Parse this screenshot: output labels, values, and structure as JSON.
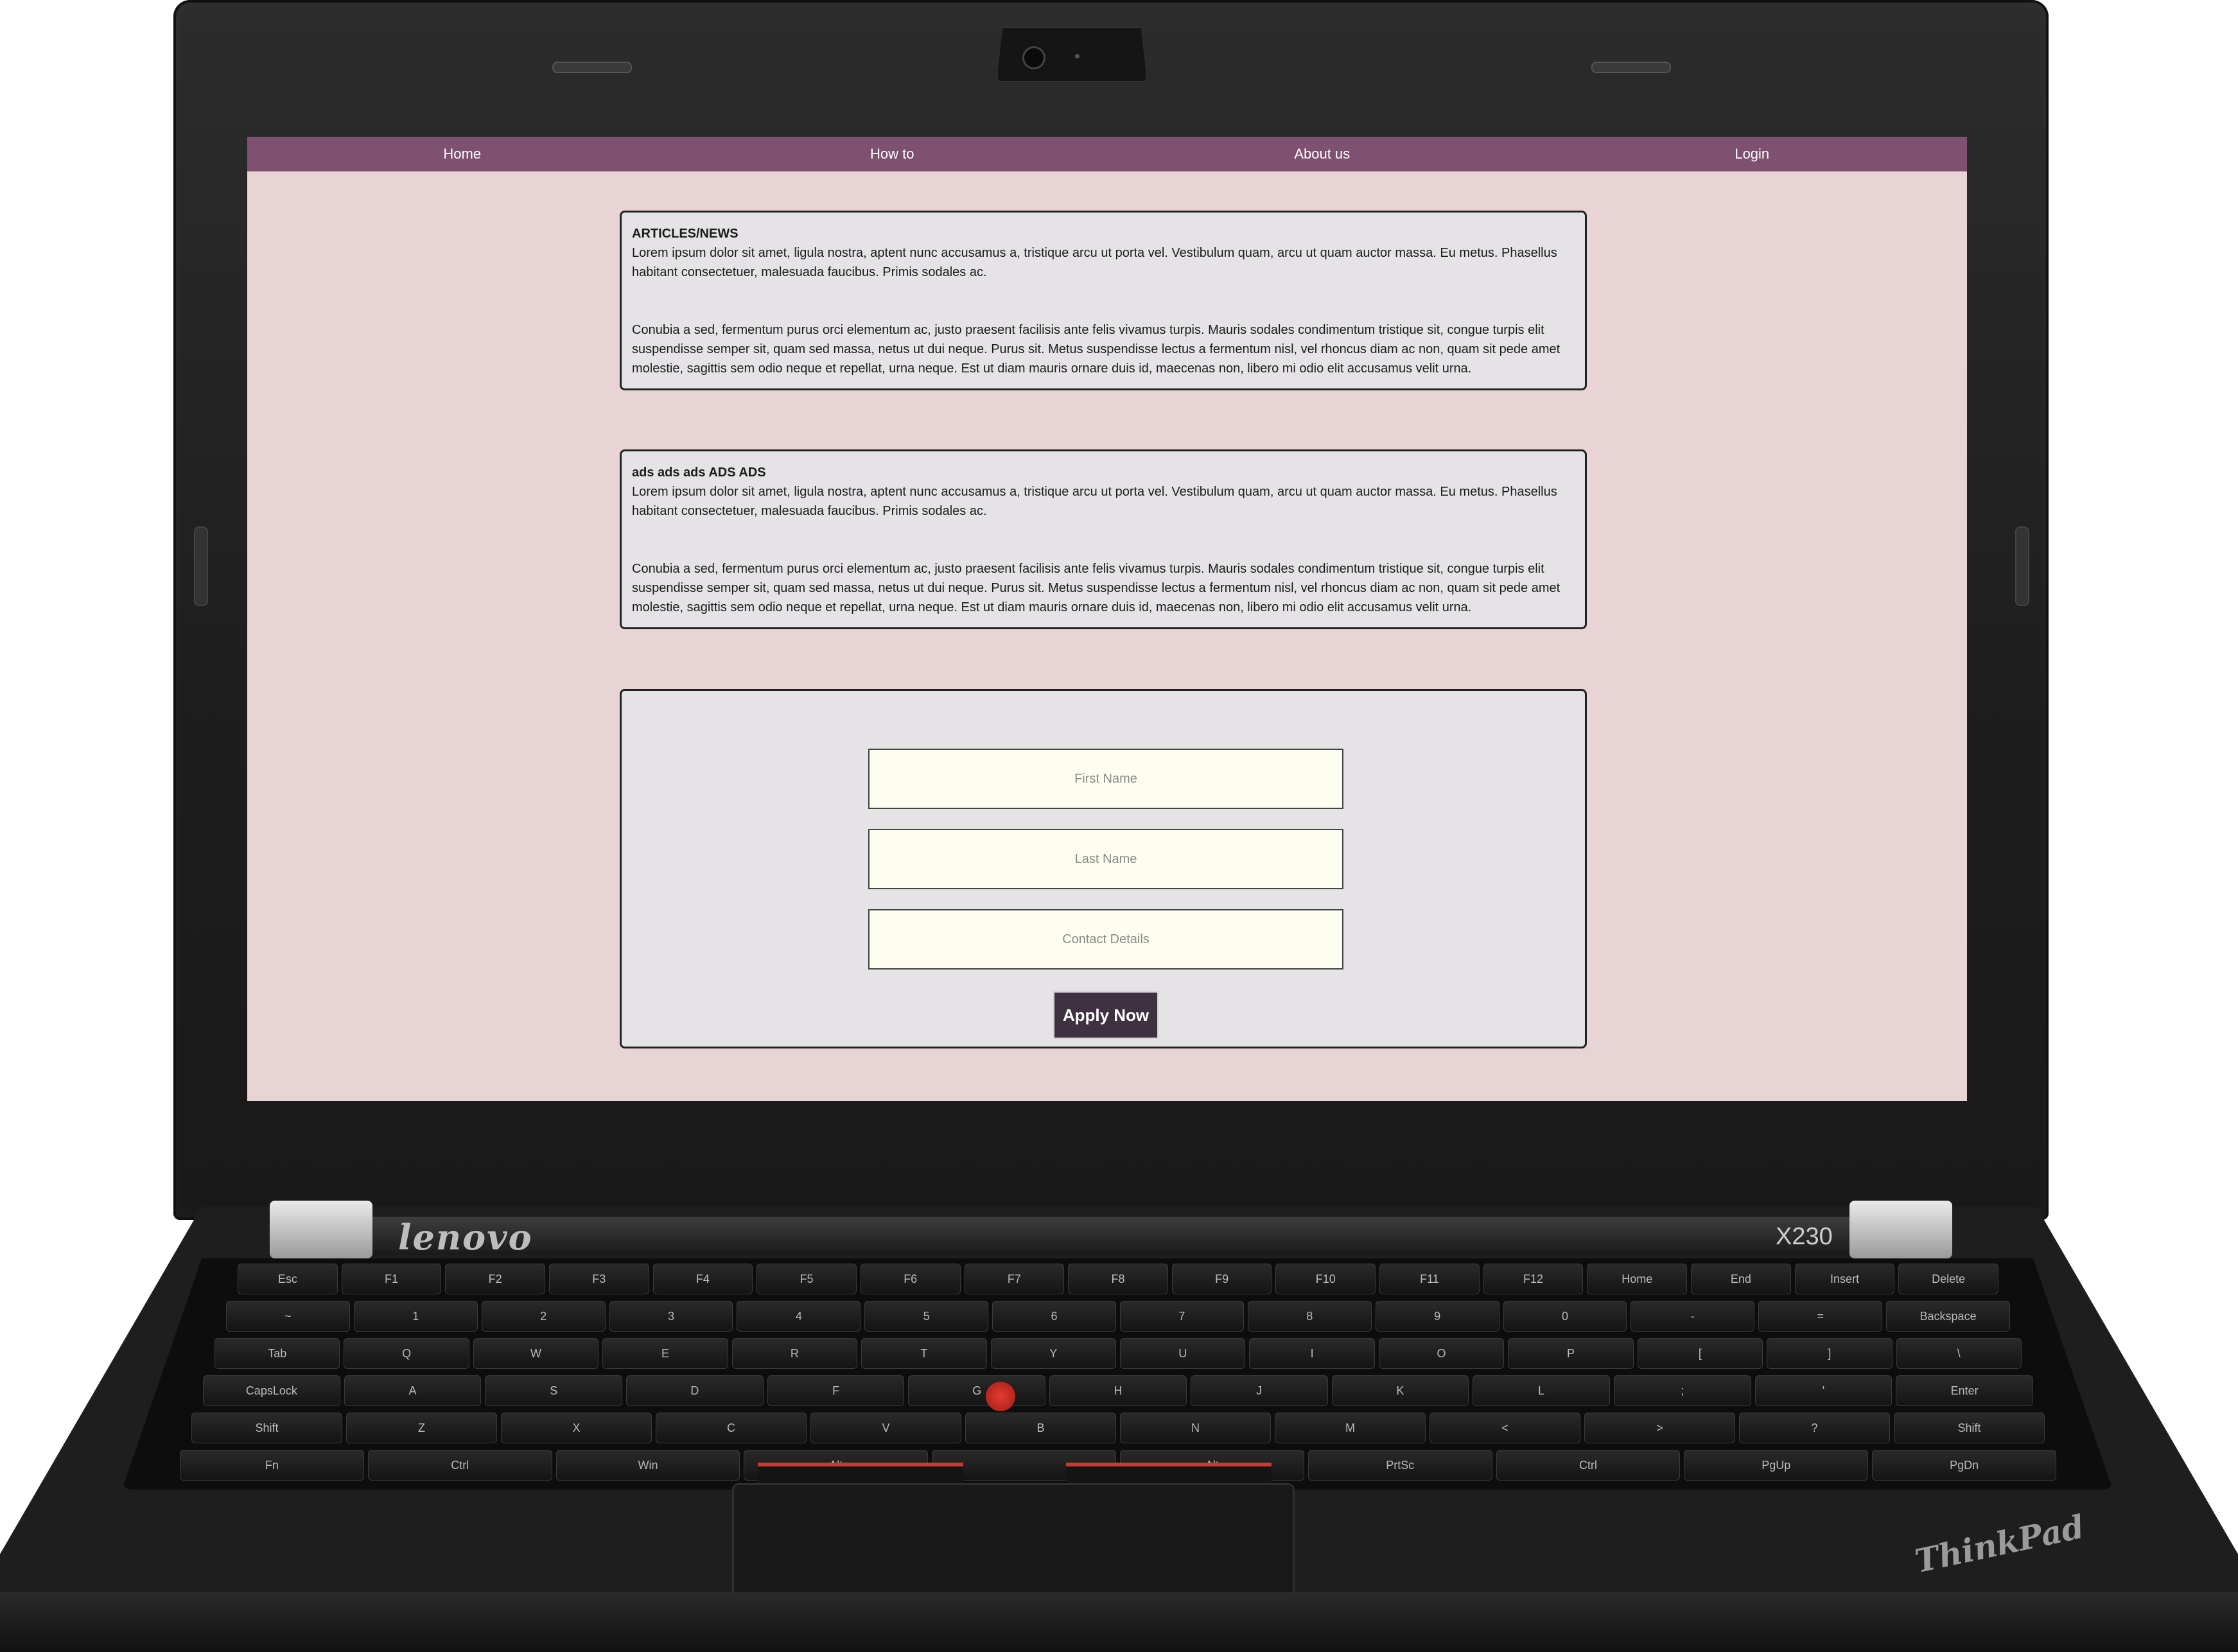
{
  "device": {
    "brand": "lenovo",
    "model": "X230",
    "logo": "ThinkPad",
    "keyboard": {
      "rows": [
        [
          "Esc",
          "F1",
          "F2",
          "F3",
          "F4",
          "F5",
          "F6",
          "F7",
          "F8",
          "F9",
          "F10",
          "F11",
          "F12",
          "Home",
          "End",
          "Insert",
          "Delete"
        ],
        [
          "~",
          "1",
          "2",
          "3",
          "4",
          "5",
          "6",
          "7",
          "8",
          "9",
          "0",
          "-",
          "=",
          "Backspace"
        ],
        [
          "Tab",
          "Q",
          "W",
          "E",
          "R",
          "T",
          "Y",
          "U",
          "I",
          "O",
          "P",
          "[",
          "]",
          "\\"
        ],
        [
          "CapsLock",
          "A",
          "S",
          "D",
          "F",
          "G",
          "H",
          "J",
          "K",
          "L",
          ";",
          "'",
          "Enter"
        ],
        [
          "Shift",
          "Z",
          "X",
          "C",
          "V",
          "B",
          "N",
          "M",
          "<",
          ">",
          "?",
          "Shift"
        ],
        [
          "Fn",
          "Ctrl",
          "Win",
          "Alt",
          "",
          "Alt",
          "PrtSc",
          "Ctrl",
          "PgUp",
          "PgDn"
        ]
      ]
    }
  },
  "nav": {
    "items": [
      "Home",
      "How to",
      "About us",
      "Login"
    ]
  },
  "articles": {
    "title": "ARTICLES/NEWS",
    "p1": "Lorem ipsum dolor sit amet, ligula nostra, aptent nunc accusamus a, tristique arcu ut porta vel. Vestibulum quam, arcu ut quam auctor massa. Eu metus. Phasellus habitant consectetuer, malesuada faucibus. Primis sodales ac.",
    "p2": "Conubia a sed, fermentum purus orci elementum ac, justo praesent facilisis ante felis vivamus turpis. Mauris sodales condimentum tristique sit, congue turpis elit suspendisse semper sit, quam sed massa, netus ut dui neque. Purus sit. Metus suspendisse lectus a fermentum nisl, vel rhoncus diam ac non, quam sit pede amet molestie, sagittis sem odio neque et repellat, urna neque. Est ut diam mauris ornare duis id, maecenas non, libero mi odio elit accusamus velit urna."
  },
  "ads": {
    "title": "ads ads ads ADS ADS",
    "p1": "Lorem ipsum dolor sit amet, ligula nostra, aptent nunc accusamus a, tristique arcu ut porta vel. Vestibulum quam, arcu ut quam auctor massa. Eu metus. Phasellus habitant consectetuer, malesuada faucibus. Primis sodales ac.",
    "p2": "Conubia a sed, fermentum purus orci elementum ac, justo praesent facilisis ante felis vivamus turpis. Mauris sodales condimentum tristique sit, congue turpis elit suspendisse semper sit, quam sed massa, netus ut dui neque. Purus sit. Metus suspendisse lectus a fermentum nisl, vel rhoncus diam ac non, quam sit pede amet molestie, sagittis sem odio neque et repellat, urna neque. Est ut diam mauris ornare duis id, maecenas non, libero mi odio elit accusamus velit urna."
  },
  "form": {
    "first_name_placeholder": "First Name",
    "first_name_value": "",
    "last_name_placeholder": "Last Name",
    "last_name_value": "",
    "contact_placeholder": "Contact Details",
    "contact_value": "",
    "submit_label": "Apply Now"
  },
  "colors": {
    "nav_bg": "#7f5170",
    "page_bg": "#e8d3d5",
    "card_bg": "#e6e3e7",
    "input_bg": "#fdfdf0",
    "button_bg": "#3f3240",
    "trackpoint": "#e23b2f"
  }
}
